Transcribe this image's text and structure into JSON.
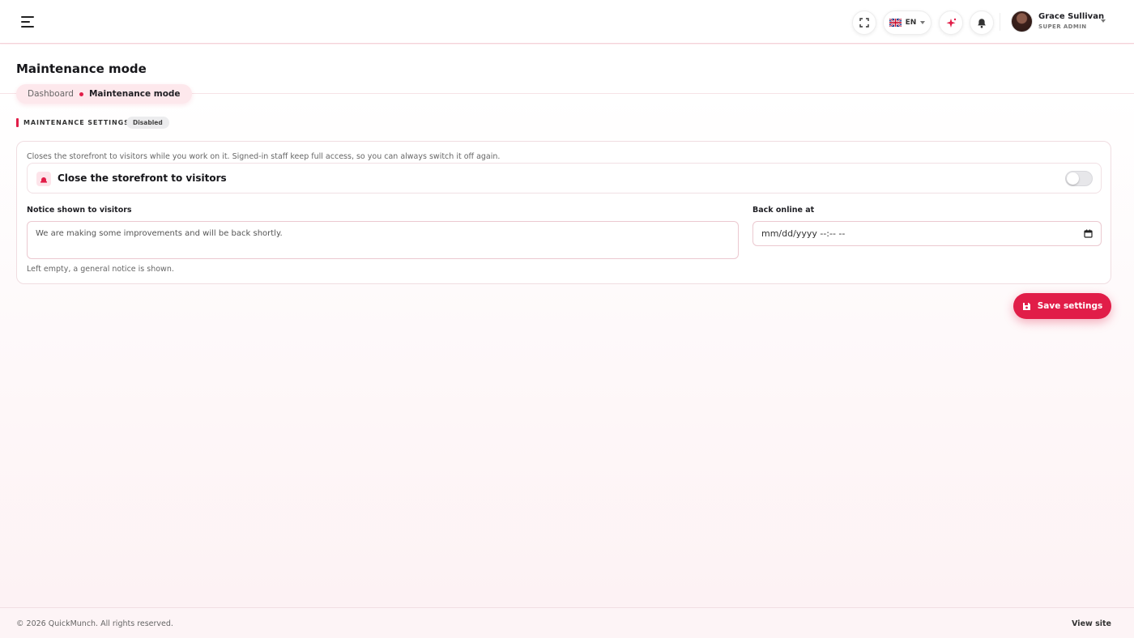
{
  "header": {
    "language_code": "EN",
    "user": {
      "name": "Grace Sullivan",
      "role": "SUPER ADMIN"
    }
  },
  "page": {
    "title": "Maintenance mode",
    "breadcrumb": {
      "parent": "Dashboard",
      "current": "Maintenance mode"
    }
  },
  "section": {
    "title": "MAINTENANCE SETTINGS",
    "status": "Disabled"
  },
  "settings": {
    "description": "Closes the storefront to visitors while you work on it. Signed-in staff keep full access, so you can always switch it off again.",
    "toggle_label": "Close the storefront to visitors",
    "toggle_on": false,
    "notice_label": "Notice shown to visitors",
    "notice_value": "We are making some improvements and will be back shortly.",
    "notice_helper": "Left empty, a general notice is shown.",
    "back_online_label": "Back online at",
    "back_online_placeholder": "mm/dd/yyyy --:-- --"
  },
  "actions": {
    "save_label": "Save settings"
  },
  "footer": {
    "copyright": "© 2026 QuickMunch. All rights reserved.",
    "view_site": "View site"
  },
  "colors": {
    "accent": "#e11d48",
    "accent_soft": "#fde8ec"
  }
}
